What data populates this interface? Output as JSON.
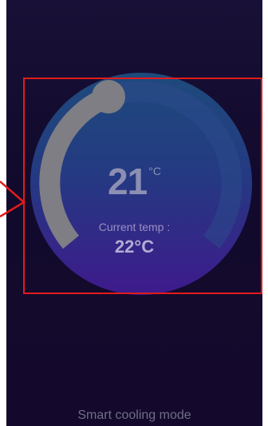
{
  "thermostat": {
    "set_temp": "21",
    "set_unit": "°C",
    "current_label": "Current temp :",
    "current_temp": "22°C",
    "mode_label": "Smart cooling mode",
    "set_temp_fraction": 0.0
  },
  "colors": {
    "background": "#140c2e",
    "dial_top": "#1e4678",
    "dial_bottom": "#3c1a8a",
    "track": "#808080",
    "highlight": "#e21b1b"
  },
  "icons": {
    "knob": "dial-knob-icon",
    "pointer": "pointer-arrow-icon"
  }
}
